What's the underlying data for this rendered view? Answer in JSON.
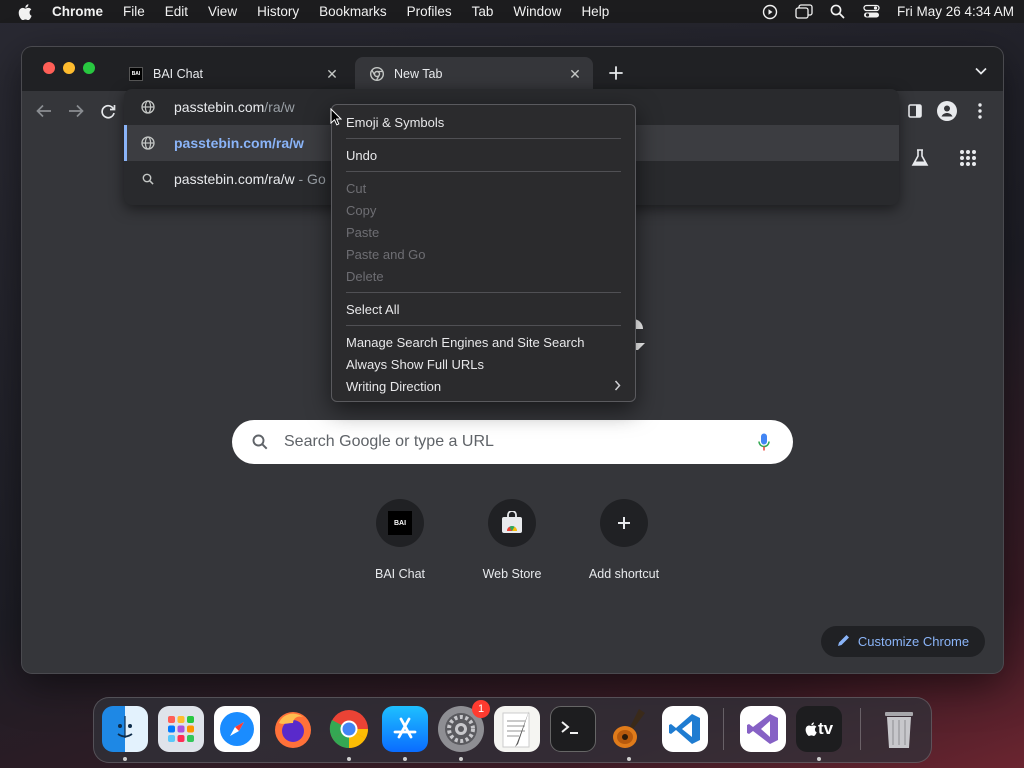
{
  "menubar": {
    "app": "Chrome",
    "items": [
      "File",
      "Edit",
      "View",
      "History",
      "Bookmarks",
      "Profiles",
      "Tab",
      "Window",
      "Help"
    ],
    "clock": "Fri May 26  4:34 AM"
  },
  "tabs": [
    {
      "title": "BAI Chat",
      "favicon_text": "BAI"
    },
    {
      "title": "New Tab"
    }
  ],
  "omnibox": {
    "typed": "passtebin.com",
    "typed_dim": "/ra/w",
    "suggestion_url": "passtebin.com/ra/w",
    "search_text": "passtebin.com/ra/w",
    "search_suffix": " - Go"
  },
  "context_menu": {
    "emoji": "Emoji & Symbols",
    "undo": "Undo",
    "cut": "Cut",
    "copy": "Copy",
    "paste": "Paste",
    "paste_go": "Paste and Go",
    "delete": "Delete",
    "select_all": "Select All",
    "manage_search": "Manage Search Engines and Site Search",
    "always_full_urls": "Always Show Full URLs",
    "writing_direction": "Writing Direction"
  },
  "ntp": {
    "search_placeholder": "Search Google or type a URL",
    "shortcuts": [
      {
        "label": "BAI Chat",
        "icon_text": "BAI"
      },
      {
        "label": "Web Store"
      },
      {
        "label": "Add shortcut"
      }
    ],
    "customize_label": "Customize Chrome"
  },
  "dock": {
    "apps": [
      "Finder",
      "Launchpad",
      "Safari",
      "Firefox",
      "Google Chrome",
      "App Store",
      "System Settings",
      "TextEdit",
      "Terminal",
      "GarageBand",
      "Visual Studio Code",
      "Visual Studio",
      "Apple TV",
      "Trash"
    ],
    "settings_badge": "1",
    "tv_label": "tv"
  },
  "colors": {
    "accent": "#8ab4f8",
    "window_bg": "#35363a",
    "tabstrip_bg": "#202124"
  }
}
